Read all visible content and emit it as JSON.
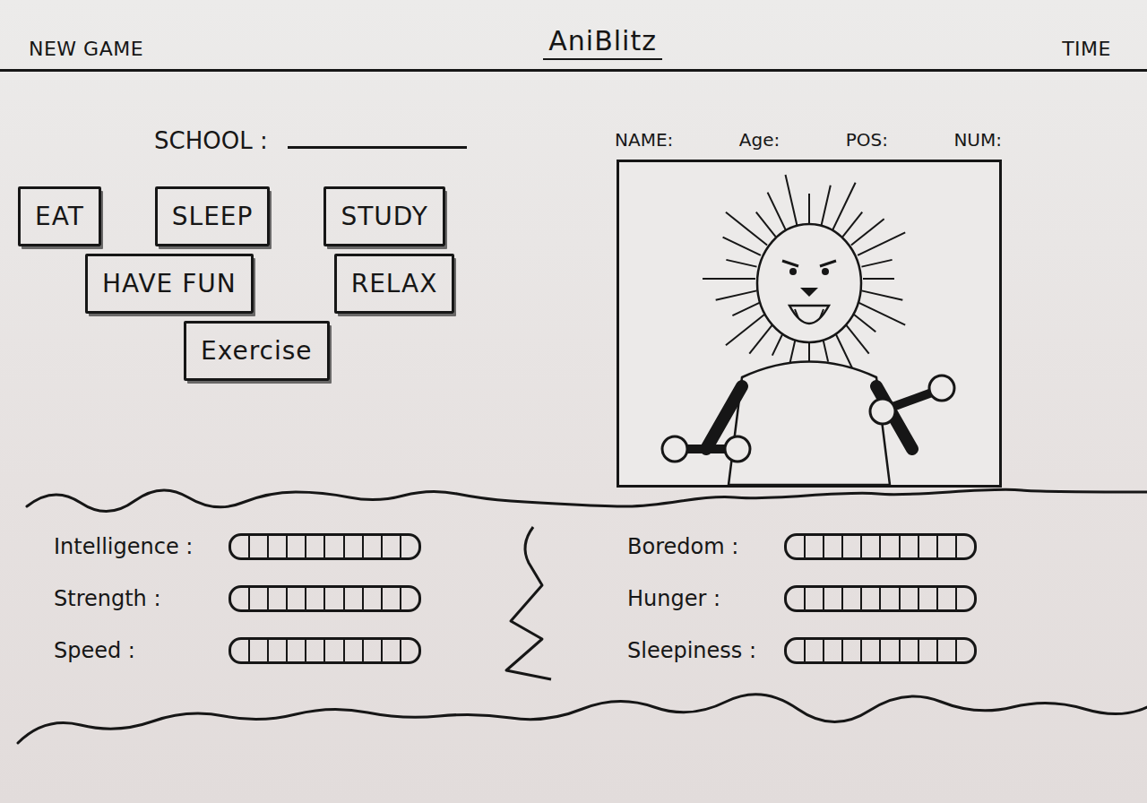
{
  "header": {
    "new_game": "NEW GAME",
    "title": "AniBlitz",
    "time": "TIME"
  },
  "school": {
    "label": "SCHOOL :"
  },
  "actions": [
    [
      {
        "label": "EAT"
      },
      {
        "label": "SLEEP"
      },
      {
        "label": "STUDY"
      }
    ],
    [
      {
        "label": "HAVE FUN"
      },
      {
        "label": "RELAX"
      }
    ],
    [
      {
        "label": "Exercise"
      }
    ]
  ],
  "player": {
    "fields": [
      "NAME:",
      "Age:",
      "POS:",
      "NUM:"
    ]
  },
  "stats": {
    "left": [
      {
        "label": "Intelligence :",
        "level": 0
      },
      {
        "label": "Strength :",
        "level": 0
      },
      {
        "label": "Speed :",
        "level": 0
      }
    ],
    "right": [
      {
        "label": "Boredom :",
        "level": 0
      },
      {
        "label": "Hunger :",
        "level": 0
      },
      {
        "label": "Sleepiness :",
        "level": 0
      }
    ]
  }
}
